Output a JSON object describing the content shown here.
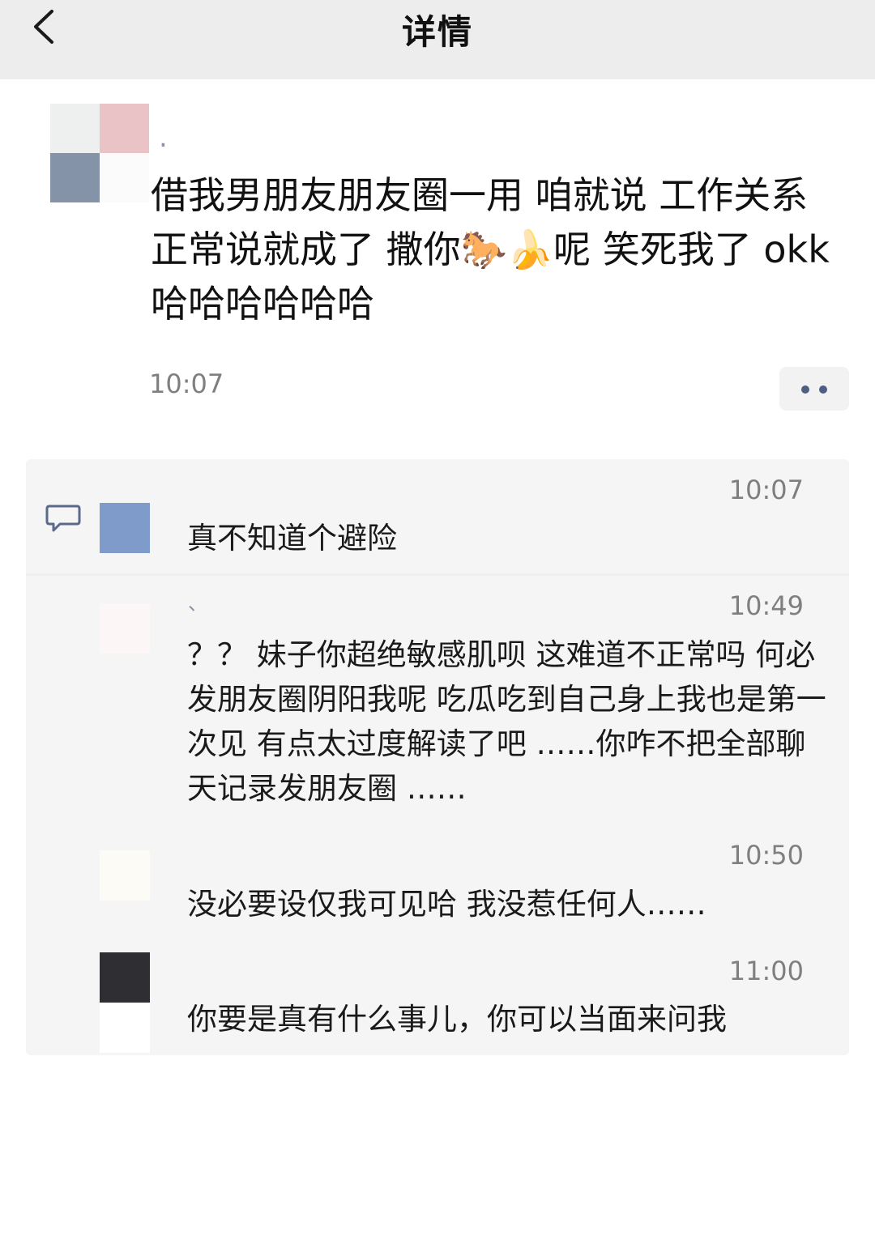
{
  "nav": {
    "title": "详情",
    "back_icon": "chevron-left-icon"
  },
  "post": {
    "author": ".",
    "text": "借我男朋友朋友圈一用 咱就说 工作关系正常说就成了 撒你🐎🍌呢 笑死我了 okk哈哈哈哈哈哈",
    "time": "10:07",
    "more_icon": "more-dots-icon"
  },
  "comments": [
    {
      "author": "",
      "time": "10:07",
      "text": "真不知道个避险"
    },
    {
      "author": "、",
      "time": "10:49",
      "text": "？？ 妹子你超绝敏感肌呗  这难道不正常吗  何必发朋友圈阴阳我呢  吃瓜吃到自己身上我也是第一次见  有点太过度解读了吧  ……你咋不把全部聊天记录发朋友圈 ……"
    },
    {
      "author": "",
      "time": "10:50",
      "text": "没必要设仅我可见哈  我没惹任何人……"
    },
    {
      "author": "",
      "time": "11:00",
      "text": "你要是真有什么事儿，你可以当面来问我"
    }
  ],
  "colors": {
    "nav_bg": "#ededed",
    "comment_bg": "#f5f5f5",
    "name_color": "#8a93a8",
    "time_color": "#7f7f7f",
    "dot_color": "#4f5f84"
  }
}
